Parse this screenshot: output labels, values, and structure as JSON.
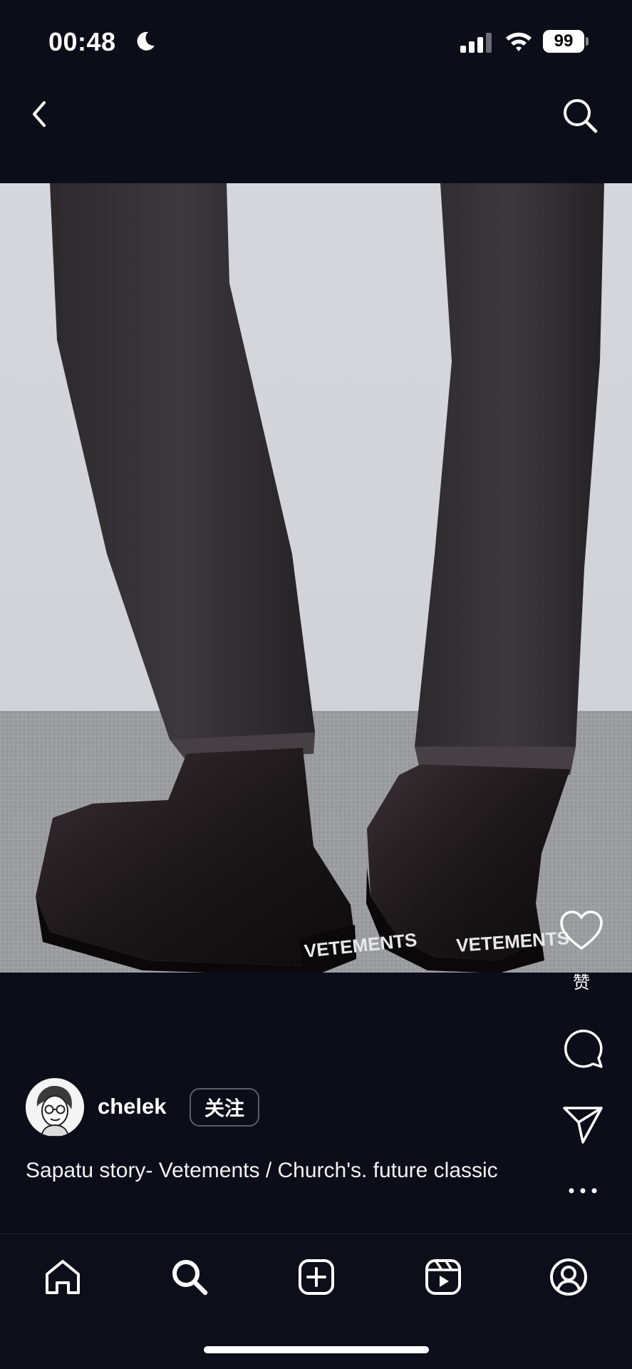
{
  "status_bar": {
    "time": "00:48",
    "battery": "99"
  },
  "post": {
    "image_text": {
      "left_boot_label": "VETEMENTS",
      "right_boot_label": "VETEMENTS"
    },
    "actions": {
      "like_label": "赞"
    },
    "author": {
      "username": "chelek",
      "follow_label": "关注"
    },
    "caption": "Sapatu story- Vetements / Church's. future classic"
  },
  "icons": {
    "status": [
      "moon-icon",
      "signal-icon",
      "wifi-icon",
      "battery-icon"
    ],
    "nav": [
      "back-icon",
      "search-icon"
    ],
    "rail": [
      "heart-icon",
      "comment-icon",
      "share-icon",
      "more-icon"
    ],
    "tabs": [
      "home-icon",
      "search-icon",
      "create-icon",
      "reels-icon",
      "profile-icon"
    ]
  },
  "colors": {
    "background": "#0b0d18",
    "text": "#ffffff",
    "follow_border": "#5a5d66"
  }
}
